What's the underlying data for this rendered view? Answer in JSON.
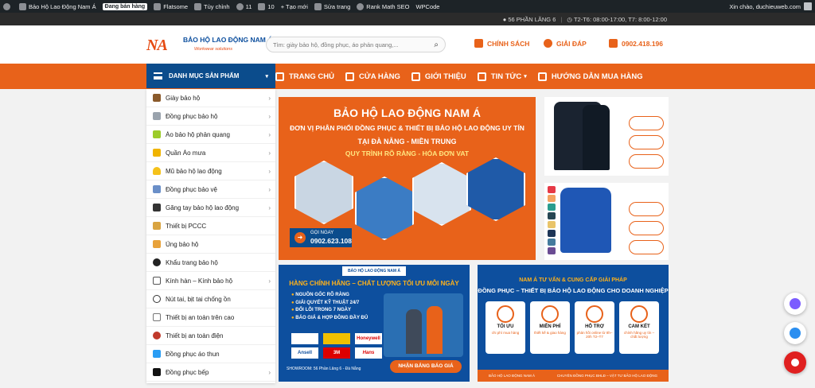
{
  "adminbar": {
    "site_name": "Bảo Hộ Lao Động Nam Á",
    "badge": "Đang bán hàng",
    "theme": "Flatsome",
    "customize": "Tùy chỉnh",
    "updates": "11",
    "comments": "10",
    "new": "+ Tạo mới",
    "edit": "Sửa trang",
    "rankmath": "Rank Math SEO",
    "wpcode": "WPCode",
    "greeting": "Xin chào, duchieuweb.com"
  },
  "topbar": {
    "address": "56 PHẦN LĂNG 6",
    "hours": "T2-T6: 08:00-17:00, T7: 8:00-12:00"
  },
  "header": {
    "logo_mark": "NA",
    "logo_title": "BẢO HỘ LAO ĐỘNG NAM Á",
    "logo_sub": "Workwear solutions",
    "search_placeholder": "Tìm: giày bảo hộ, đồng phục, áo phản quang,...",
    "policy": "CHÍNH SÁCH",
    "faq": "GIẢI ĐÁP",
    "phone": "0902.418.196"
  },
  "nav": {
    "category_button": "DANH MỤC SẢN PHẨM",
    "items": [
      "TRANG CHỦ",
      "CỬA HÀNG",
      "GIỚI THIỆU",
      "TIN TỨC",
      "HƯỚNG DẪN MUA HÀNG"
    ]
  },
  "categories": [
    {
      "label": "Giày bảo hộ",
      "arrow": true
    },
    {
      "label": "Đồng phục bảo hộ",
      "arrow": true
    },
    {
      "label": "Áo bảo hộ phản quang",
      "arrow": true
    },
    {
      "label": "Quần Áo mưa",
      "arrow": true
    },
    {
      "label": "Mũ bảo hộ lao động",
      "arrow": true
    },
    {
      "label": "Đồng phục bảo vệ",
      "arrow": true
    },
    {
      "label": "Găng tay bảo hộ lao động",
      "arrow": true
    },
    {
      "label": "Thiết bị PCCC",
      "arrow": false
    },
    {
      "label": "Ủng bảo hộ",
      "arrow": false
    },
    {
      "label": "Khẩu trang bảo hộ",
      "arrow": false
    },
    {
      "label": "Kính hàn – Kính bảo hộ",
      "arrow": true
    },
    {
      "label": "Nút tai, bịt tai chống ồn",
      "arrow": false
    },
    {
      "label": "Thiết bị an toàn trên cao",
      "arrow": false
    },
    {
      "label": "Thiết bị an toàn điện",
      "arrow": false
    },
    {
      "label": "Đồng phục áo thun",
      "arrow": false
    },
    {
      "label": "Đồng phục bếp",
      "arrow": true
    }
  ],
  "hero": {
    "title": "BẢO HỘ LAO ĐỘNG NAM Á",
    "line1": "ĐƠN VỊ PHÂN PHỐI ĐỒNG PHỤC & THIẾT BỊ BẢO HỘ LAO ĐỘNG UY TÍN",
    "line2": "TẠI ĐÀ NẴNG - MIỀN TRUNG",
    "line3": "QUY TRÌNH RÕ RÀNG - HÓA ĐƠN VAT",
    "call_label": "GỌI NGAY",
    "call_number": "0902.623.108"
  },
  "banner1": {
    "logo": "BẢO HỘ LAO ĐỘNG NAM Á",
    "headline": "HÀNG CHÍNH HÃNG – CHẤT LƯỢNG TỐI ƯU MỖI NGÀY",
    "bullets": [
      "NGUỒN GỐC RÕ RÀNG",
      "GIẢI QUYẾT KỸ THUẬT 24/7",
      "ĐỔI LỖI TRONG 7 NGÀY",
      "BÁO GIÁ & HỢP ĐỒNG ĐẦY ĐỦ"
    ],
    "brands": [
      "Honeywell",
      "Ansell",
      "3M",
      "Hans"
    ],
    "address": "SHOWROOM: 56 Phần Lăng 6 - Đà Nẵng",
    "cta": "NHẬN BẢNG BÁO GIÁ"
  },
  "banner2": {
    "title1": "NAM Á TƯ VẤN & CUNG CẤP GIẢI PHÁP",
    "title2": "ĐỒNG PHỤC – THIẾT BỊ BẢO HỘ LAO ĐỘNG CHO DOANH NGHIỆP",
    "cards": [
      {
        "title": "TỐI ƯU",
        "sub": "chi phí mua hàng"
      },
      {
        "title": "MIỄN PHÍ",
        "sub": "thiết kế & giao hàng"
      },
      {
        "title": "HỖ TRỢ",
        "sub": "phản hồi online từ 8h–20h T2–T7"
      },
      {
        "title": "CAM KẾT",
        "sub": "chính hãng uy tín – chất lượng"
      }
    ],
    "footer_left": "BẢO HỘ LAO ĐỘNG NAM Á",
    "footer_right": "CHUYÊN ĐỒNG PHỤC BHLĐ – VẬT TƯ BẢO HỘ LAO ĐỘNG"
  },
  "colors": {
    "brand_orange": "#e8621a",
    "brand_blue": "#0b4c8c",
    "admin_bar": "#1d2327"
  }
}
